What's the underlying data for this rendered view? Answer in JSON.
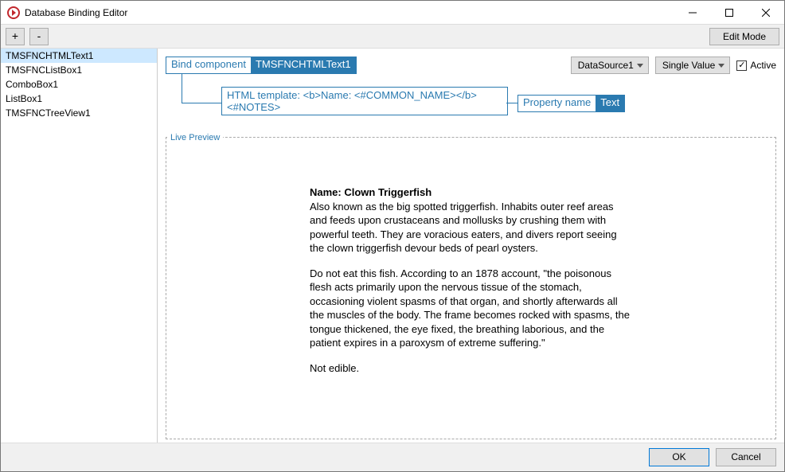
{
  "window": {
    "title": "Database Binding Editor"
  },
  "toolbar": {
    "add_label": "+",
    "remove_label": "-",
    "editmode_label": "Edit Mode"
  },
  "sidebar": {
    "items": [
      {
        "label": "TMSFNCHTMLText1",
        "selected": true
      },
      {
        "label": "TMSFNCListBox1",
        "selected": false
      },
      {
        "label": "ComboBox1",
        "selected": false
      },
      {
        "label": "ListBox1",
        "selected": false
      },
      {
        "label": "TMSFNCTreeView1",
        "selected": false
      }
    ]
  },
  "binding": {
    "component_label": "Bind component",
    "component_value": "TMSFNCHTMLText1",
    "datasource_value": "DataSource1",
    "mode_value": "Single Value",
    "active_label": "Active",
    "active_checked": "✓",
    "template_text": "HTML template: <b>Name: <#COMMON_NAME></b> <#NOTES>",
    "property_label": "Property name",
    "property_value": "Text"
  },
  "preview": {
    "label": "Live Preview",
    "name_header": "Name: Clown Triggerfish",
    "para1": "Also known as the big spotted triggerfish.  Inhabits outer reef areas and feeds upon crustaceans and mollusks by crushing them with powerful teeth.  They are voracious eaters, and divers report seeing the clown triggerfish devour beds of pearl oysters.",
    "para2": "Do not eat this fish.  According to an 1878 account, \"the poisonous flesh acts primarily upon the nervous tissue of the stomach, occasioning violent spasms of that organ, and shortly afterwards all the muscles of the body.  The frame becomes rocked with spasms, the tongue thickened, the eye fixed, the breathing laborious, and the patient expires in a paroxysm of extreme suffering.\"",
    "para3": "Not edible."
  },
  "footer": {
    "ok_label": "OK",
    "cancel_label": "Cancel"
  }
}
